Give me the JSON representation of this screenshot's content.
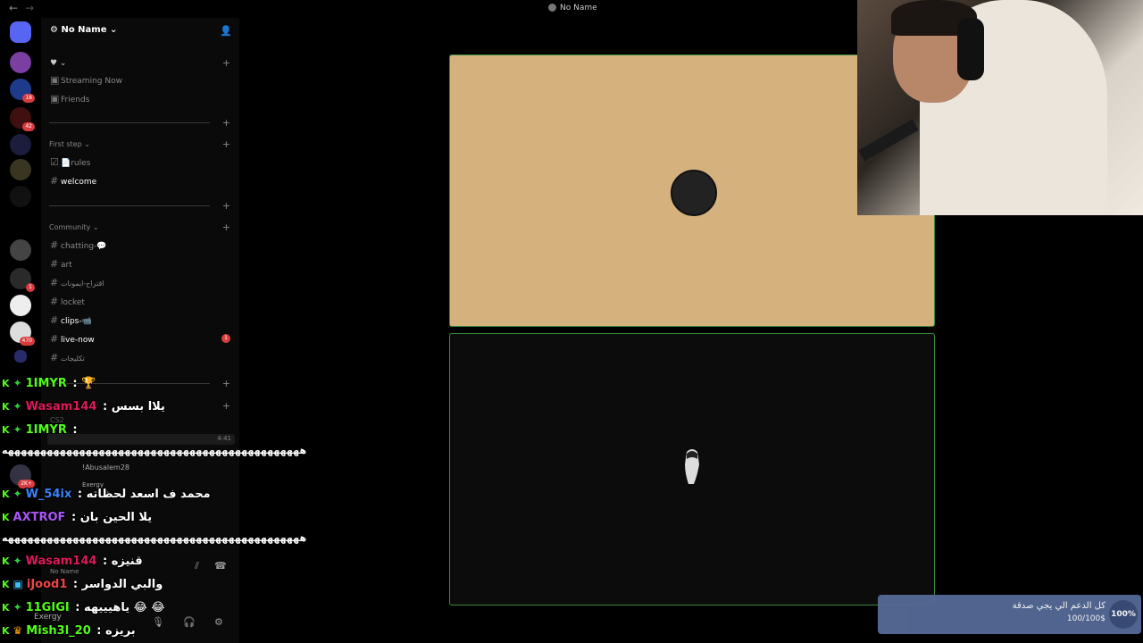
{
  "window": {
    "title": "No Name",
    "back_icon": "←",
    "forward_icon": "→"
  },
  "server_rail": {
    "badges": [
      "18",
      "42",
      "1",
      "470",
      "2K+"
    ]
  },
  "sidebar": {
    "server_name": "No Name ⌄",
    "heart_dropdown": "♥ ⌄",
    "streaming_now": "Streaming Now",
    "friends": "Friends",
    "cat_first_step": "First step ⌄",
    "rules": "📄rules",
    "welcome": "welcome",
    "cat_community": "Community ⌄",
    "chatting": "chatting-💬",
    "art": "art",
    "suggestions": "اقتراح-ايمونات",
    "locket": "locket",
    "clips": "clips-📹",
    "live_now": "live-now",
    "live_now_badge": "1",
    "challenges": "تكليجات",
    "voice_cs2": "CS2",
    "voice_time": "4:41",
    "member1": "!Abusalem28",
    "member2": "Exergy"
  },
  "user_panel": {
    "name": "Exergy",
    "server": "No Name"
  },
  "chat": [
    {
      "user": "1IMYR",
      "color": "#53fc18",
      "msg": "🏆"
    },
    {
      "user": "Wasam144",
      "color": "#e0195b",
      "msg": "يلاا بسس"
    },
    {
      "user": "1IMYR",
      "color": "#53fc18",
      "msg": ""
    },
    {
      "user": "W_54ix",
      "color": "#3b82f6",
      "msg": "محمد ف اسعد لحظاته"
    },
    {
      "user": "AXTROF",
      "color": "#a855f7",
      "msg": "يلا الحين بان"
    },
    {
      "user": "Wasam144",
      "color": "#e0195b",
      "msg": "قنيزه"
    },
    {
      "user": "iJood1",
      "color": "#ef4444",
      "msg": "والبي الدواسر"
    },
    {
      "user": "11GIGI",
      "color": "#53fc18",
      "msg": "ياهيييهه 😂 😂"
    },
    {
      "user": "Mish3l_20",
      "color": "#53fc18",
      "msg": "بريزه"
    }
  ],
  "spam_line": "ههههههههههههههههههههههههههههههههههههههههههههههه",
  "donation": {
    "text": "كل الدعم الي يجي صدقة",
    "amount": "100/100$",
    "percent": "100%"
  },
  "colors": {
    "tile_top": "#d5b17d",
    "tile_border": "#3a8a3a",
    "kick_green": "#53fc18"
  }
}
